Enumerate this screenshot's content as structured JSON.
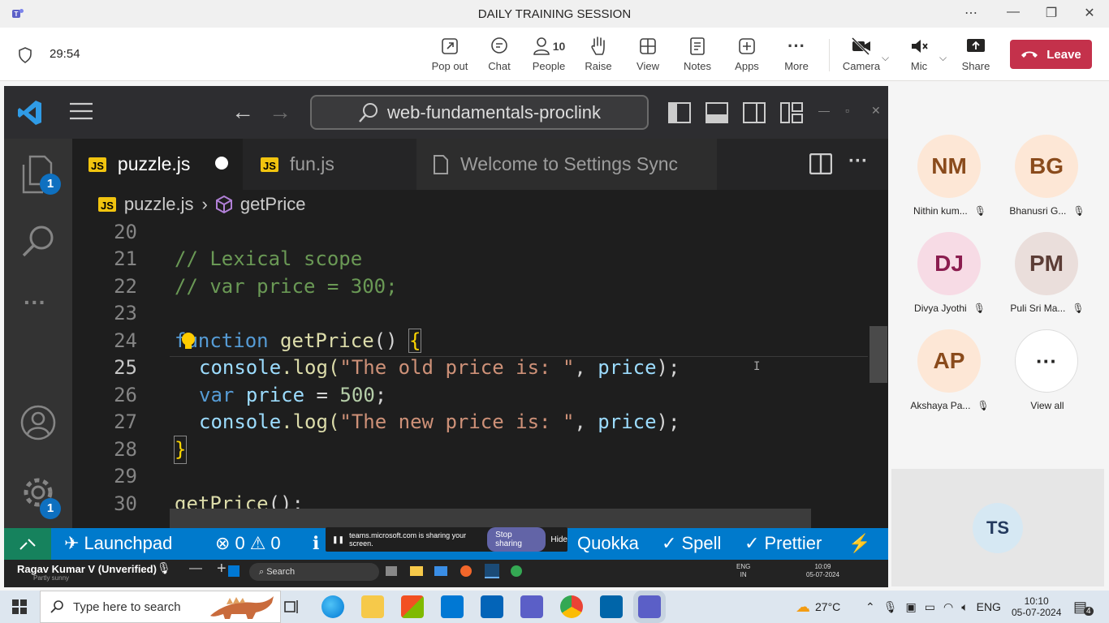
{
  "window": {
    "title": "DAILY TRAINING SESSION"
  },
  "meeting": {
    "timer": "29:54",
    "toolbar": {
      "popout": "Pop out",
      "chat": "Chat",
      "people": "People",
      "people_count": "10",
      "raise": "Raise",
      "view": "View",
      "notes": "Notes",
      "apps": "Apps",
      "more": "More",
      "camera": "Camera",
      "mic": "Mic",
      "share": "Share",
      "leave": "Leave"
    }
  },
  "vscode": {
    "search": "web-fundamentals-proclink",
    "explorer_badge": "1",
    "settings_badge": "1",
    "tabs": [
      "puzzle.js",
      "fun.js",
      "Welcome to Settings Sync"
    ],
    "js_label": "JS",
    "breadcrumb": {
      "file": "puzzle.js",
      "symbol": "getPrice"
    },
    "code": {
      "l20": "20",
      "l21": "21",
      "l22": "22",
      "l23": "23",
      "l24": "24",
      "l25": "25",
      "l26": "26",
      "l27": "27",
      "l28": "28",
      "l29": "29",
      "l30": "30",
      "c21": "// Lexical scope",
      "c22": "// var price = 300;",
      "kw_function": "function",
      "fn_getPrice": "getPrice",
      "paren_open": "()",
      "brace_open": "{",
      "console": "console",
      "log": ".log(",
      "str_old": "\"The old price is: \"",
      "comma": ", ",
      "price": "price",
      "close_semicolon": ");",
      "kw_var": "var",
      "assign": " = ",
      "num_500": "500",
      "semicolon": ";",
      "str_new": "\"The new price is: \"",
      "brace_close": "}",
      "call_paren": "();"
    },
    "status": {
      "launchpad": "Launchpad",
      "errors": "0",
      "warnings": "0",
      "quokka": "Quokka",
      "spell": "Spell",
      "prettier": "Prettier"
    }
  },
  "share_toast": {
    "text": "teams.microsoft.com is sharing your screen.",
    "stop": "Stop sharing",
    "hide": "Hide"
  },
  "presenter": {
    "name": "Ragav Kumar V (Unverified)",
    "sub": "Partly sunny"
  },
  "inner_taskbar": {
    "search": "Search",
    "lang": "ENG",
    "region": "IN",
    "time": "10:09",
    "date": "05-07-2024"
  },
  "participants": [
    {
      "initials": "NM",
      "name": "Nithin kum...",
      "bg": "#fde7d6",
      "fg": "#8a4b1c"
    },
    {
      "initials": "BG",
      "name": "Bhanusri G...",
      "bg": "#fde7d6",
      "fg": "#8a4b1c"
    },
    {
      "initials": "DJ",
      "name": "Divya Jyothi",
      "bg": "#f7dbe5",
      "fg": "#8b1d4f"
    },
    {
      "initials": "PM",
      "name": "Puli Sri Ma...",
      "bg": "#eadedb",
      "fg": "#5c3d36"
    },
    {
      "initials": "AP",
      "name": "Akshaya Pa...",
      "bg": "#fde7d6",
      "fg": "#8a4b1c"
    },
    {
      "initials": "",
      "name": "View all",
      "bg": "#ffffff",
      "fg": "#252423"
    }
  ],
  "self": {
    "initials": "TS"
  },
  "taskbar": {
    "search": "Type here to search",
    "temp": "27°C",
    "lang": "ENG",
    "time": "10:10",
    "date": "05-07-2024",
    "notif": "4"
  }
}
